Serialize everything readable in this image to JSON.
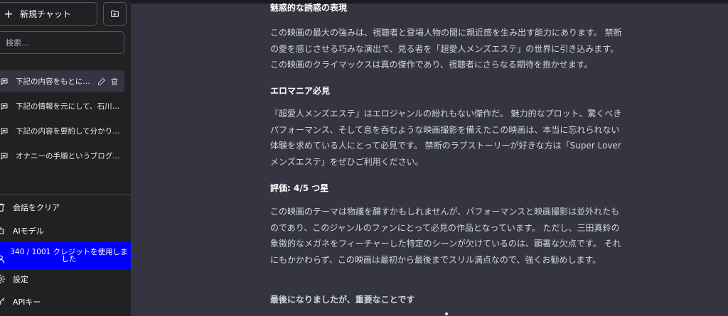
{
  "sidebar": {
    "new_chat_label": "新規チャット",
    "search_placeholder": "検索...",
    "conversations": [
      {
        "title": "下記の内容をもとにし..."
      },
      {
        "title": "下記の情報を元にして、石川澪..."
      },
      {
        "title": "下記の内容を要約して分かり易..."
      },
      {
        "title": "オナニーの手順というブログ記..."
      }
    ],
    "clear_label": "会話をクリア",
    "model_label": "AIモデル",
    "credits_label": "340 / 1001 クレジットを使用しました",
    "settings_label": "設定",
    "api_label": "APIキー"
  },
  "article": {
    "heading1": "魅惑的な誘惑の表現",
    "para1": "この映画の最大の強みは、視聴者と登場人物の間に親近感を生み出す能力にあります。 禁断の愛を感じさせる巧みな演出で、見る者を「超愛人メンズエステ」の世界に引き込みます。 この映画のクライマックスは真の傑作であり、視聴者にさらなる期待を抱かせます。",
    "heading2": "エロマニア必見",
    "para2": "『超愛人メンズエステ』はエロジャンルの紛れもない傑作だ。 魅力的なプロット、驚くべきパフォーマンス、そして息を呑むような映画撮影を備えたこの映画は、本当に忘れられない体験を求めている人にとって必見です。 禁断のラブストーリーが好きな方は「Super Loverメンズエステ」をぜひご利用ください。",
    "heading3": "評価: 4/5 つ星",
    "para3": "この映画のテーマは物議を醸すかもしれませんが、パフォーマンスと映画撮影は並外れたものであり、このジャンルのファンにとって必見の作品となっています。 ただし、三田真鈴の象徴的なメガネをフィーチャーした特定のシーンが欠けているのは、顕著な欠点です。 それにもかかわらず、この映画は最初から最後までスリル満点なので、強くお勧めします。",
    "heading4": "最後になりましたが、重要なことです"
  },
  "icons": {
    "new_chat": "plus-icon",
    "folder": "new-folder-icon",
    "conversation": "chat-bubble-icon",
    "edit": "pencil-icon",
    "delete": "trash-icon",
    "clear": "trash-icon",
    "model": "robot-icon",
    "credits": "user-icon",
    "settings": "gear-icon",
    "api": "key-icon"
  },
  "colors": {
    "sidebar_bg": "#202123",
    "main_bg": "#343541",
    "credits_bg": "#0000ff"
  }
}
